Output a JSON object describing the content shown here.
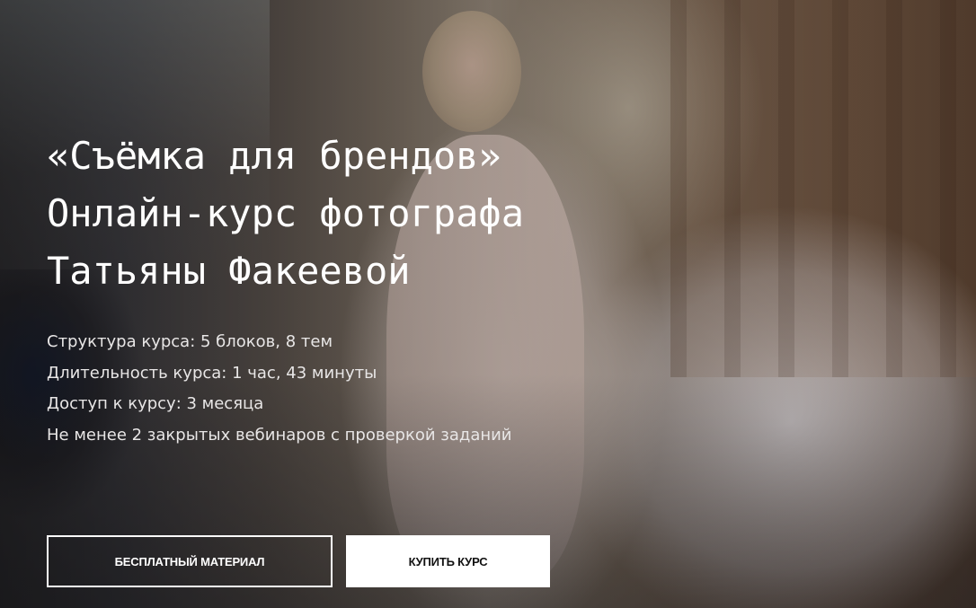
{
  "hero": {
    "title_lines": [
      "«Съёмка для брендов»",
      "Онлайн-курс фотографа",
      "Татьяны Факеевой"
    ],
    "facts": [
      "Структура курса: 5 блоков, 8 тем",
      "Длительность курса: 1 час, 43 минуты",
      "Доступ к курсу: 3 месяца",
      "Не менее 2 закрытых вебинаров с проверкой заданий"
    ],
    "buttons": {
      "free_material": "БЕСПЛАТНЫЙ МАТЕРИАЛ",
      "buy_course": "КУПИТЬ КУРС"
    }
  },
  "colors": {
    "text": "#ffffff",
    "button_fill": "#ffffff",
    "button_dark_text": "#111111"
  }
}
